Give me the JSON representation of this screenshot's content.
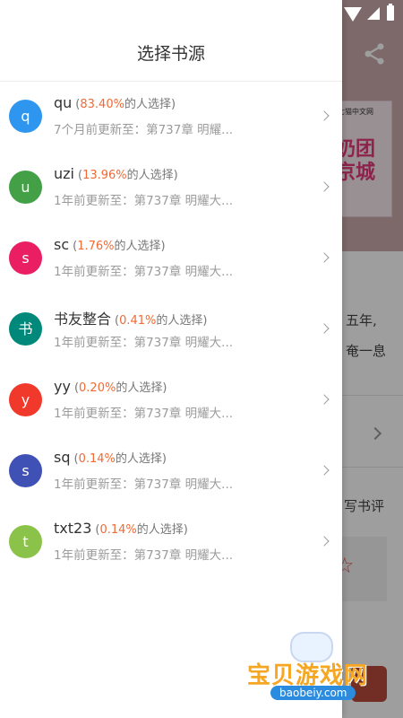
{
  "drawer": {
    "title": "选择书源",
    "items": [
      {
        "avatar": "q",
        "color": "#2f96f0",
        "name": "qu",
        "pct_open": "(",
        "pct": "83.40%",
        "pct_close": "的人选择)",
        "subtitle": "7个月前更新至：第737章 明耀..."
      },
      {
        "avatar": "u",
        "color": "#43a047",
        "name": "uzi",
        "pct_open": "(",
        "pct": "13.96%",
        "pct_close": "的人选择)",
        "subtitle": "1年前更新至：第737章 明耀大..."
      },
      {
        "avatar": "s",
        "color": "#e91e63",
        "name": "sc",
        "pct_open": "(",
        "pct": "1.76%",
        "pct_close": "的人选择)",
        "subtitle": "1年前更新至：第737章 明耀大..."
      },
      {
        "avatar": "书",
        "color": "#00897b",
        "name": "书友整合",
        "pct_open": "(",
        "pct": "0.41%",
        "pct_close": "的人选择)",
        "subtitle": "1年前更新至：第737章 明耀大..."
      },
      {
        "avatar": "y",
        "color": "#f0392b",
        "name": "yy",
        "pct_open": "(",
        "pct": "0.20%",
        "pct_close": "的人选择)",
        "subtitle": "1年前更新至：第737章 明耀大..."
      },
      {
        "avatar": "s",
        "color": "#3f51b5",
        "name": "sq",
        "pct_open": "(",
        "pct": "0.14%",
        "pct_close": "的人选择)",
        "subtitle": "1年前更新至：第737章 明耀大..."
      },
      {
        "avatar": "t",
        "color": "#8bc34a",
        "name": "txt23",
        "pct_open": "(",
        "pct": "0.14%",
        "pct_close": "的人选择)",
        "subtitle": "1年前更新至：第737章 明耀大..."
      }
    ]
  },
  "background": {
    "cover_tag": "七猫中文网",
    "cover_title": "奶团\n京城",
    "text_line1": "五年,",
    "text_line2": "奄一息",
    "write_review": "写书评"
  },
  "watermark": {
    "main": "宝贝游戏网",
    "domain": "baobeiy.com"
  }
}
